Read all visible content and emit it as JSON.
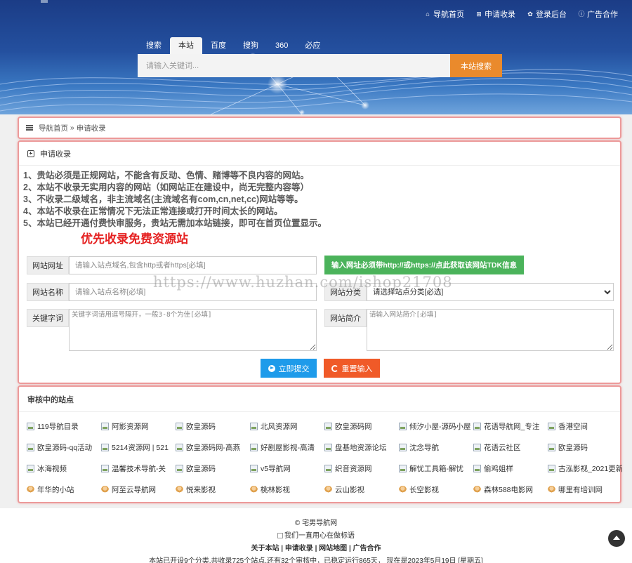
{
  "topnav": [
    {
      "icon": "home-icon",
      "glyph": "⌂",
      "label": "导航首页"
    },
    {
      "icon": "plus-square-icon",
      "glyph": "⊞",
      "label": "申请收录"
    },
    {
      "icon": "paw-icon",
      "glyph": "✿",
      "label": "登录后台"
    },
    {
      "icon": "info-icon",
      "glyph": "ⓘ",
      "label": "广告合作"
    }
  ],
  "search": {
    "tabs": [
      "搜索",
      "本站",
      "百度",
      "搜狗",
      "360",
      "必应"
    ],
    "active_tab": "本站",
    "placeholder": "请输入关键词...",
    "button": "本站搜索"
  },
  "breadcrumb": {
    "home": "导航首页",
    "sep": " » ",
    "current": "申请收录"
  },
  "form": {
    "title": "申请收录",
    "rules": [
      "1、贵站必须是正规网站，不能含有反动、色情、赌博等不良内容的网站。",
      "2、本站不收录无实用内容的网站（如网站正在建设中，尚无完整内容等）",
      "3、不收录二级域名，非主流域名(主流域名有com,cn,net,cc)网站等等。",
      "4、本站不收录在正常情况下无法正常连接或打开时间太长的网站。",
      "5、本站已经开通付费快审服务，贵站无需加本站链接，即可在首页位置显示。"
    ],
    "highlight": "优先收录免费资源站",
    "url_label": "网站网址",
    "url_placeholder": "请输入站点域名,包含http或者https[必填]",
    "tdk_button": "输入网址必须带http://或https://点此获取该网站TDK信息",
    "name_label": "网站名称",
    "name_placeholder": "请输入站点名称[必填]",
    "category_label": "网站分类",
    "category_selected": "请选择站点分类[必选]",
    "keywords_label": "关键字词",
    "keywords_placeholder": "关键字词请用逗号隔开，一般3-8个为佳[必填]",
    "desc_label": "网站简介",
    "desc_placeholder": "请输入网站简介[必填]",
    "submit": "立即提交",
    "reset": "重置输入"
  },
  "watermark": "https://www.huzhan.com/ishop21708",
  "pending": {
    "title": "审核中的站点",
    "sites": [
      {
        "name": "119导航目录",
        "icon": "image-icon"
      },
      {
        "name": "阿影资源网",
        "icon": "image-icon"
      },
      {
        "name": "欧皇源码",
        "icon": "image-icon"
      },
      {
        "name": "北风资源网",
        "icon": "image-icon"
      },
      {
        "name": "欧皇源码网",
        "icon": "image-icon"
      },
      {
        "name": "倾汐小屋-源码小屋",
        "icon": "image-icon"
      },
      {
        "name": "花语导航网_专注",
        "icon": "image-icon"
      },
      {
        "name": "香港空间",
        "icon": "image-icon"
      },
      {
        "name": "欧皇源码-qq活动",
        "icon": "image-icon"
      },
      {
        "name": "5214资源网 | 521",
        "icon": "image-icon"
      },
      {
        "name": "欧皇源码网-高燕",
        "icon": "image-icon"
      },
      {
        "name": "好剧屋影视-高清",
        "icon": "image-icon"
      },
      {
        "name": "盘基地资源论坛",
        "icon": "image-icon"
      },
      {
        "name": "沈念导航",
        "icon": "image-icon"
      },
      {
        "name": "花语云社区",
        "icon": "image-icon"
      },
      {
        "name": "欧皇源码",
        "icon": "image-icon"
      },
      {
        "name": "冰海视频",
        "icon": "image-icon"
      },
      {
        "name": "温馨技术导航-关",
        "icon": "image-icon"
      },
      {
        "name": "欧皇源码",
        "icon": "image-icon"
      },
      {
        "name": "v5导航网",
        "icon": "image-icon"
      },
      {
        "name": "织音资源网",
        "icon": "image-icon"
      },
      {
        "name": "解忧工具箱-解忧",
        "icon": "image-icon"
      },
      {
        "name": "偷鸡姐样",
        "icon": "image-icon"
      },
      {
        "name": "古泓影视_2021更新",
        "icon": "image-icon"
      },
      {
        "name": "年华的小站",
        "icon": "avatar-icon"
      },
      {
        "name": "阿至云导航网",
        "icon": "avatar-icon"
      },
      {
        "name": "悦来影视",
        "icon": "avatar-icon"
      },
      {
        "name": "桃林影视",
        "icon": "avatar-icon"
      },
      {
        "name": "云山影视",
        "icon": "avatar-icon"
      },
      {
        "name": "长空影视",
        "icon": "avatar-icon"
      },
      {
        "name": "森林588电影网",
        "icon": "avatar-icon"
      },
      {
        "name": "哪里有培训网",
        "icon": "avatar-icon"
      }
    ]
  },
  "footer": {
    "copyright": "© 宅男导航网",
    "slogan_img_alt": "我们一直用心在做标语",
    "links": [
      "关于本站",
      "申请收录",
      "网站地图",
      "广告合作"
    ],
    "link_sep": " | ",
    "stats": "本站已开设9个分类,共收录725个站点,还有32个审核中，已稳定运行865天， 现在是2023年5月19日 [星期五]"
  }
}
